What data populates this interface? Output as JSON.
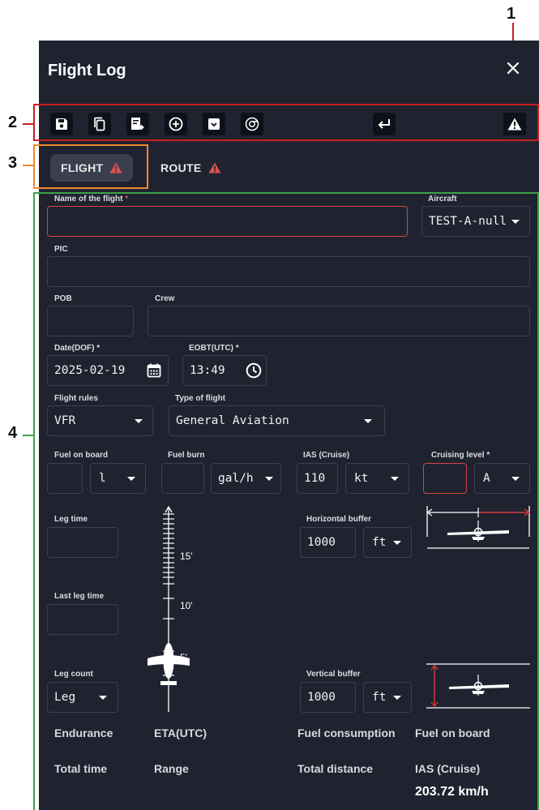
{
  "callouts": [
    "1",
    "2",
    "3",
    "4"
  ],
  "colors": {
    "panel": "#1f2330",
    "callout_red": "#c82020",
    "callout_orange": "#f08a2c",
    "callout_green": "#3ca24a",
    "warning": "#e05050"
  },
  "header": {
    "title": "Flight Log",
    "close_icon": "close-icon"
  },
  "toolbar": {
    "icons": [
      "save-icon",
      "copy-icon",
      "export-icon",
      "add-circle-icon",
      "archive-icon",
      "clear-icon",
      "return-icon",
      "warning-icon"
    ]
  },
  "tabs": [
    {
      "label": "FLIGHT",
      "active": true,
      "warning": true
    },
    {
      "label": "ROUTE",
      "active": false,
      "warning": true
    }
  ],
  "form": {
    "name_label": "Name of the flight",
    "name_value": "",
    "aircraft_label": "Aircraft",
    "aircraft_value": "TEST-A-null",
    "pic_label": "PIC",
    "pob_label": "POB",
    "crew_label": "Crew",
    "date_label": "Date(DOF) *",
    "date_value": "2025-02-19",
    "eobt_label": "EOBT(UTC) *",
    "eobt_value": "13:49",
    "flight_rules_label": "Flight rules",
    "flight_rules_value": "VFR",
    "type_label": "Type of flight",
    "type_value": "General Aviation",
    "fuel_on_board_label": "Fuel on board",
    "fuel_unit": "l",
    "fuel_burn_label": "Fuel burn",
    "fuel_burn_unit": "gal/h",
    "ias_label": "IAS (Cruise)",
    "ias_value": "110",
    "ias_unit": "kt",
    "cruising_label": "Cruising level *",
    "cruising_unit": "A",
    "leg_time_label": "Leg time",
    "last_leg_time_label": "Last leg time",
    "leg_count_label": "Leg count",
    "leg_count_value": "Leg",
    "hbuffer_label": "Horizontal buffer",
    "hbuffer_value": "1000",
    "hbuffer_unit": "ft",
    "vbuffer_label": "Vertical buffer",
    "vbuffer_value": "1000",
    "vbuffer_unit": "ft"
  },
  "scale": {
    "ticks": [
      "15'",
      "10'",
      "5'"
    ]
  },
  "summary": {
    "endurance": "Endurance",
    "eta": "ETA(UTC)",
    "fuel_consumption": "Fuel consumption",
    "fuel_on_board": "Fuel on board",
    "total_time": "Total time",
    "range": "Range",
    "total_distance": "Total distance",
    "ias": "IAS (Cruise)",
    "ias_value": "203.72 km/h"
  }
}
